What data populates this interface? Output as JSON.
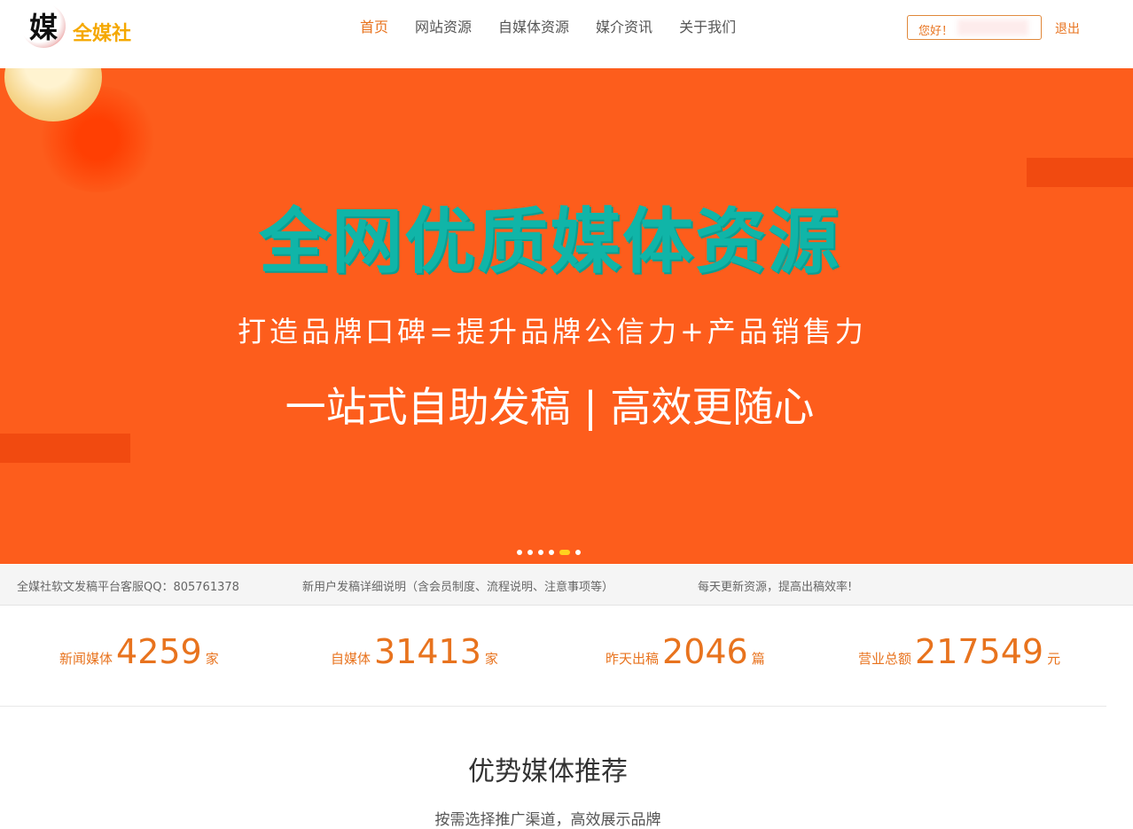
{
  "header": {
    "logo_char": "媒",
    "logo_text": "全媒社",
    "nav": [
      "首页",
      "网站资源",
      "自媒体资源",
      "媒介资讯",
      "关于我们"
    ],
    "greeting": "您好！",
    "logout": "退出"
  },
  "banner": {
    "title": "全网优质媒体资源",
    "subtitle": "打造品牌口碑=提升品牌公信力+产品销售力",
    "slogan": "一站式自助发稿 | 高效更随心",
    "slides": 6,
    "active_slide": 5
  },
  "notices": [
    "全媒社软文发稿平台客服QQ：805761378",
    "新用户发稿详细说明（含会员制度、流程说明、注意事项等）",
    "每天更新资源，提高出稿效率!"
  ],
  "stats": [
    {
      "label": "新闻媒体",
      "value": "4259",
      "unit": "家"
    },
    {
      "label": "自媒体",
      "value": "31413",
      "unit": "家"
    },
    {
      "label": "昨天出稿",
      "value": "2046",
      "unit": "篇"
    },
    {
      "label": "营业总额",
      "value": "217549",
      "unit": "元"
    }
  ],
  "section": {
    "title": "优势媒体推荐",
    "subtitle": "按需选择推广渠道，高效展示品牌"
  },
  "colors": {
    "accent": "#e8731e",
    "banner_bg": "#fd5d1c",
    "banner_title": "#10b5a8",
    "dot_active": "#ffd21f"
  }
}
